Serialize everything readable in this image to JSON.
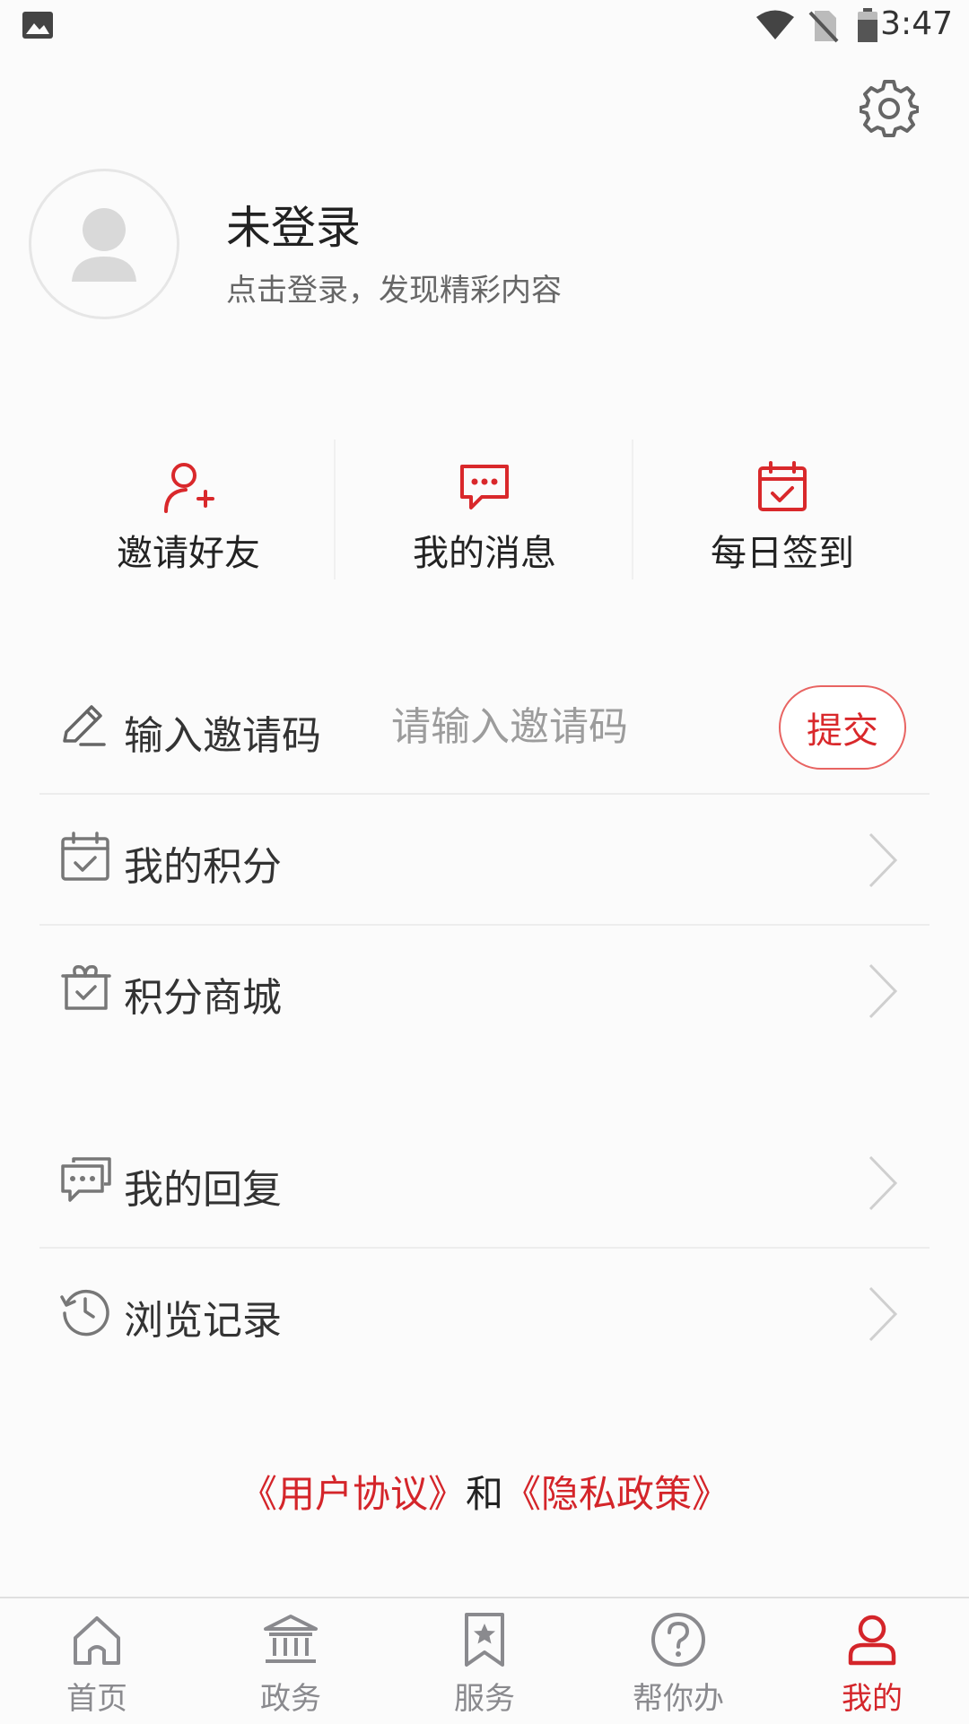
{
  "status_bar": {
    "time": "3:47"
  },
  "profile": {
    "name": "未登录",
    "subtitle": "点击登录，发现精彩内容"
  },
  "quick_actions": [
    {
      "label": "邀请好友",
      "icon": "add-user-icon"
    },
    {
      "label": "我的消息",
      "icon": "message-icon"
    },
    {
      "label": "每日签到",
      "icon": "calendar-check-icon"
    }
  ],
  "invite": {
    "label": "输入邀请码",
    "placeholder": "请输入邀请码",
    "submit_label": "提交"
  },
  "menu": [
    {
      "label": "我的积分",
      "icon": "calendar-check-icon"
    },
    {
      "label": "积分商城",
      "icon": "gift-box-icon"
    },
    {
      "label": "我的回复",
      "icon": "chat-bubbles-icon"
    },
    {
      "label": "浏览记录",
      "icon": "history-icon"
    }
  ],
  "agreement": {
    "user_agreement": "《用户协议》",
    "and": "和",
    "privacy_policy": "《隐私政策》"
  },
  "bottom_nav": [
    {
      "label": "首页",
      "icon": "home-icon",
      "active": false
    },
    {
      "label": "政务",
      "icon": "government-icon",
      "active": false
    },
    {
      "label": "服务",
      "icon": "bookmark-star-icon",
      "active": false
    },
    {
      "label": "帮你办",
      "icon": "question-icon",
      "active": false
    },
    {
      "label": "我的",
      "icon": "user-icon",
      "active": true
    }
  ],
  "colors": {
    "accent": "#d4252a",
    "inactive": "#8a8a8e",
    "background": "#fbfbfb"
  }
}
